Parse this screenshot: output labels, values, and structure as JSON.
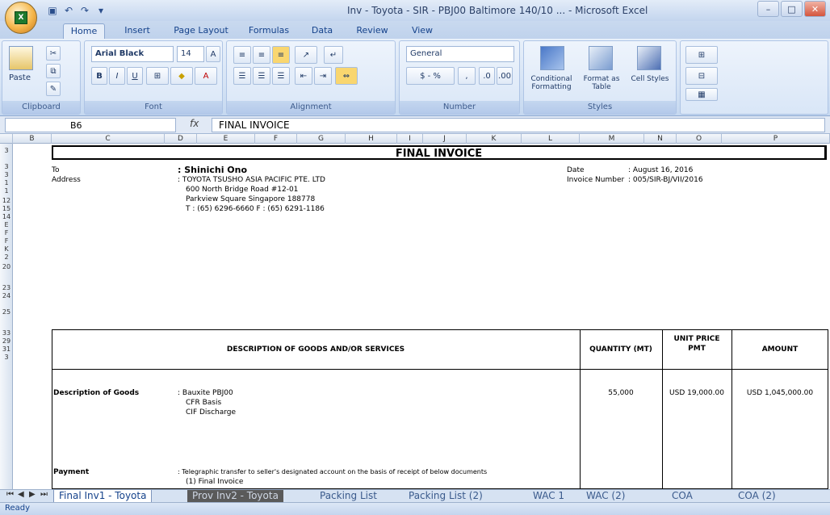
{
  "window": {
    "title": "Inv - Toyota - SIR - PBJ00 Baltimore 140/10 ... - Microsoft Excel"
  },
  "tabs": [
    "Home",
    "Insert",
    "Page Layout",
    "Formulas",
    "Data",
    "Review",
    "View"
  ],
  "ribbon": {
    "clipboard": {
      "label": "Clipboard",
      "paste": "Paste"
    },
    "font": {
      "label": "Font",
      "name": "Arial Black",
      "size": "14"
    },
    "alignment": {
      "label": "Alignment"
    },
    "number": {
      "label": "Number",
      "format": "General",
      "currency": "$ - %"
    },
    "styles": {
      "label": "Styles",
      "conditional": "Conditional Formatting",
      "format_table": "Format as Table",
      "cell_styles": "Cell Styles"
    }
  },
  "formula_bar": {
    "name_box": "B6",
    "fx": "fx",
    "formula": "FINAL INVOICE"
  },
  "columns": [
    "B",
    "C",
    "D",
    "E",
    "F",
    "G",
    "H",
    "I",
    "J",
    "K",
    "L",
    "M",
    "N",
    "O",
    "P"
  ],
  "rows": [
    "3",
    "3",
    "3",
    "1",
    "1",
    "12",
    "15",
    "14",
    "E",
    "F",
    "F",
    "K",
    "2",
    "20",
    "",
    "23",
    "24",
    "",
    "25",
    "",
    "33",
    "29",
    "31",
    "3"
  ],
  "invoice": {
    "title": "FINAL INVOICE",
    "to_label": "To",
    "to_value": ": Shinichi Ono",
    "address_label": "Address",
    "address_lines": [
      ": TOYOTA TSUSHO ASIA PACIFIC PTE. LTD",
      "600 North Bridge Road #12-01",
      "Parkview Square Singapore 188778",
      "T : (65) 6296-6660  F : (65) 6291-1186"
    ],
    "date_label": "Date",
    "date_value": ": August 16, 2016",
    "invoice_no_label": "Invoice Number",
    "invoice_no_value": ": 005/SIR-BJ/VII/2016",
    "table_header": {
      "description": "DESCRIPTION OF GOODS AND/OR SERVICES",
      "quantity": "QUANTITY (MT)",
      "unit_price": "UNIT PRICE PMT",
      "amount": "AMOUNT"
    },
    "desc_label": "Description of Goods",
    "desc_lines": [
      ": Bauxite PBJ00",
      "CFR Basis",
      "CIF Discharge"
    ],
    "qty": "55,000",
    "unit_price": "USD 19,000.00",
    "amount": "USD 1,045,000.00",
    "payment_label": "Payment",
    "payment_lines": [
      ": Telegraphic transfer to seller's designated account on the basis of receipt of below documents",
      "(1) Final Invoice"
    ]
  },
  "sheet_tabs": [
    "Final Inv1 - Toyota",
    "Prov Inv2 - Toyota",
    "Packing List",
    "Packing List (2)",
    "WAC 1",
    "WAC (2)",
    "COA",
    "COA (2)"
  ],
  "status": "Ready"
}
